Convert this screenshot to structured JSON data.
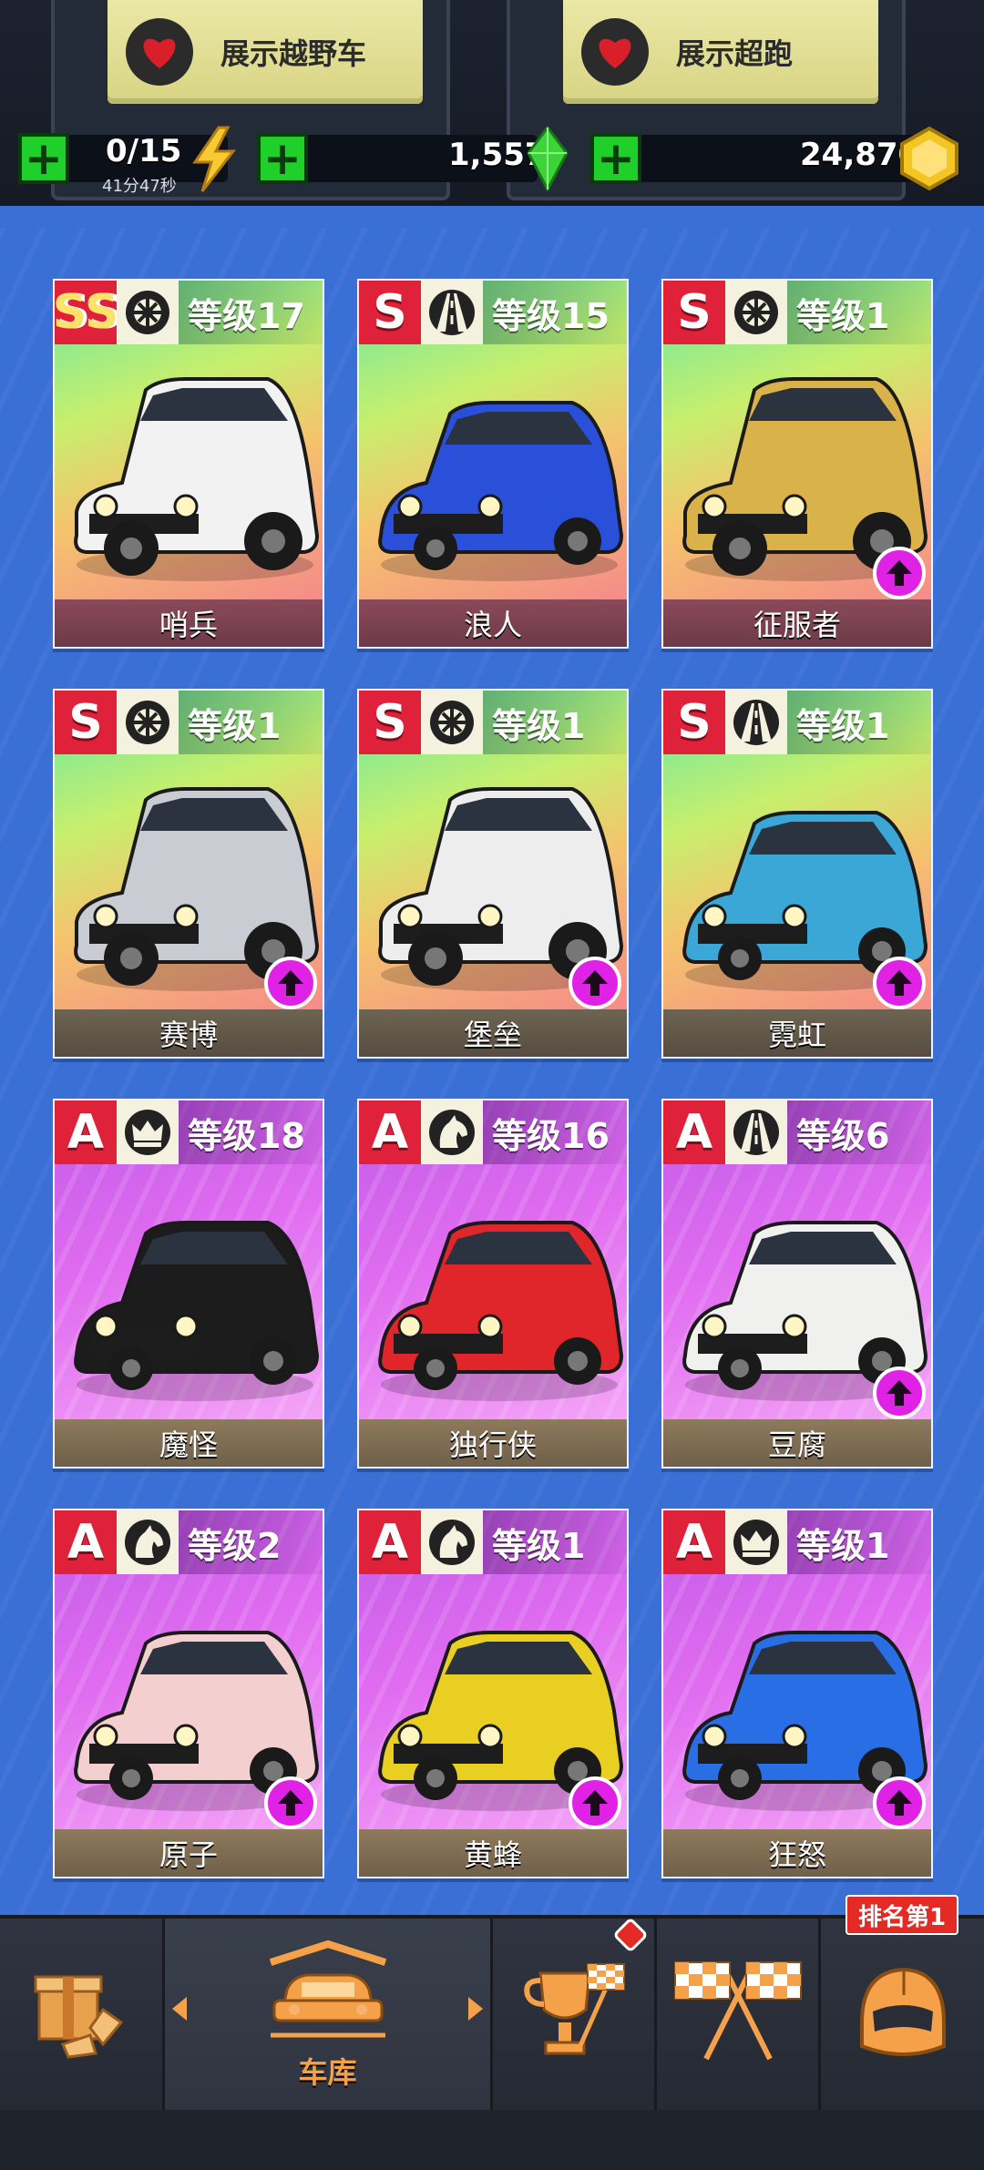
{
  "header": {
    "show_offroad_label": "展示越野车",
    "show_supercar_label": "展示超跑",
    "energy": "0/15",
    "energy_timer": "41分47秒",
    "gems": "1,557",
    "coins": "24,870",
    "plus_symbol": "+"
  },
  "cars": [
    {
      "class": "SS",
      "tier": "S",
      "spec": "wheel-icon",
      "level": "等级17",
      "name": "哨兵",
      "upgrade": false,
      "color": "#f2f2f2"
    },
    {
      "class": "S",
      "tier": "S",
      "spec": "road-icon",
      "level": "等级15",
      "name": "浪人",
      "upgrade": false,
      "color": "#2a4fd8"
    },
    {
      "class": "S",
      "tier": "S",
      "spec": "wheel-icon",
      "level": "等级1",
      "name": "征服者",
      "upgrade": true,
      "color": "#d9b24a"
    },
    {
      "class": "S",
      "tier": "S",
      "spec": "wheel-icon",
      "level": "等级1",
      "name": "赛博",
      "upgrade": true,
      "color": "#c9ccd2"
    },
    {
      "class": "S",
      "tier": "S",
      "spec": "wheel-icon",
      "level": "等级1",
      "name": "堡垒",
      "upgrade": true,
      "color": "#ededed"
    },
    {
      "class": "S",
      "tier": "S",
      "spec": "road-icon",
      "level": "等级1",
      "name": "霓虹",
      "upgrade": true,
      "color": "#3aa7d6"
    },
    {
      "class": "A",
      "tier": "A",
      "spec": "crown-icon",
      "level": "等级18",
      "name": "魔怪",
      "upgrade": false,
      "color": "#1c1c1c"
    },
    {
      "class": "A",
      "tier": "A",
      "spec": "horse-icon",
      "level": "等级16",
      "name": "独行侠",
      "upgrade": false,
      "color": "#e0262a"
    },
    {
      "class": "A",
      "tier": "A",
      "spec": "road-icon",
      "level": "等级6",
      "name": "豆腐",
      "upgrade": true,
      "color": "#f0f0ee"
    },
    {
      "class": "A",
      "tier": "A",
      "spec": "horse-icon",
      "level": "等级2",
      "name": "原子",
      "upgrade": true,
      "color": "#f3cfcf"
    },
    {
      "class": "A",
      "tier": "A",
      "spec": "horse-icon",
      "level": "等级1",
      "name": "黄蜂",
      "upgrade": true,
      "color": "#e8cf21"
    },
    {
      "class": "A",
      "tier": "A",
      "spec": "crown-icon",
      "level": "等级1",
      "name": "狂怒",
      "upgrade": true,
      "color": "#2a6ee6"
    }
  ],
  "nav": {
    "garage_label": "车库",
    "rank_label": "排名第1",
    "items": [
      "shop-icon",
      "garage-icon",
      "trophy-icon",
      "race-flags-icon",
      "helmet-icon"
    ]
  },
  "colors": {
    "background": "#3a6fd6",
    "s_tier_red": "#e0213a",
    "upgrade_magenta": "#e021e6",
    "accent_orange": "#f4a14a",
    "plus_green": "#1fcf2a"
  }
}
